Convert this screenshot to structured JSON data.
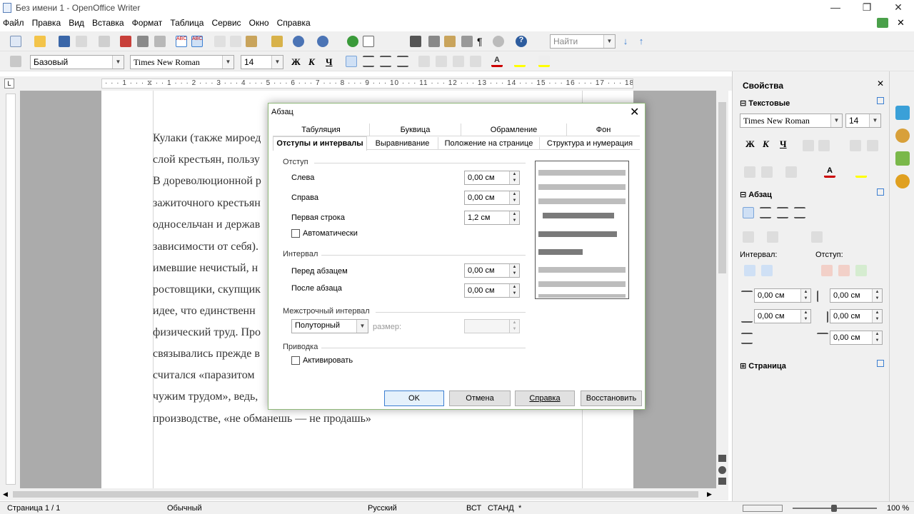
{
  "window": {
    "title": "Без имени 1 - OpenOffice Writer"
  },
  "menu": [
    "Файл",
    "Правка",
    "Вид",
    "Вставка",
    "Формат",
    "Таблица",
    "Сервис",
    "Окно",
    "Справка"
  ],
  "toolbar": {
    "find_placeholder": "Найти"
  },
  "formatting": {
    "style": "Базовый",
    "font": "Times New Roman",
    "size": "14",
    "bold": "Ж",
    "italic": "К",
    "underline": "Ч"
  },
  "ruler": {
    "marks": "· · · 1 · · · ⧖ · · 1 · · · 2 · · · 3 · · · 4 · · · 5 · · · 6 · · · 7 · · · 8 · · · 9 · · · 10 · · · 11 · · · 12 · · · 13 · · · 14 · · · 15 · · · 16 · · · 17 · · · 18 · ·"
  },
  "document": {
    "lines": [
      "Кулаки (также мироед",
      "слой крестьян, пользу",
      "В дореволюционной р",
      "зажиточного крестьян",
      "односельчан и держав",
      "зависимости от себя).",
      "имевшие нечистый, н",
      "ростовщики, скупщик",
      "идее, что единственн",
      "физический труд. Про",
      "связывались прежде в",
      "считался «паразитом",
      "чужим трудом», ведь,",
      "производстве, «не обманешь — не продашь»"
    ]
  },
  "status": {
    "page": "Страница  1 / 1",
    "style": "Обычный",
    "lang": "Русский",
    "mode1": "ВСТ",
    "mode2": "СТАНД",
    "mode3": "*",
    "zoom": "100 %"
  },
  "sidebar": {
    "title": "Свойства",
    "text_section": "Текстовые",
    "font": "Times New Roman",
    "size": "14",
    "bold": "Ж",
    "italic": "К",
    "underline": "Ч",
    "para_section": "Абзац",
    "interval_label": "Интервал:",
    "indent_label": "Отступ:",
    "spin_values": [
      "0,00 см",
      "0,00 см",
      "0,00 см",
      "0,00 см",
      "0,00 см"
    ],
    "page_section": "Страница"
  },
  "dialog": {
    "title": "Абзац",
    "tabs_row1": [
      "Табуляция",
      "Буквица",
      "Обрамление",
      "Фон"
    ],
    "tabs_row2": [
      "Отступы и интервалы",
      "Выравнивание",
      "Положение на странице",
      "Структура и нумерация"
    ],
    "indent_section": "Отступ",
    "left_label": "Слева",
    "left_value": "0,00 см",
    "right_label": "Справа",
    "right_value": "0,00 см",
    "first_line_label": "Первая строка",
    "first_line_value": "1,2 см",
    "auto_label": "Автоматически",
    "spacing_section": "Интервал",
    "before_label": "Перед абзацем",
    "before_value": "0,00 см",
    "after_label": "После абзаца",
    "after_value": "0,00 см",
    "line_spacing_section": "Межстрочный интервал",
    "line_spacing_value": "Полуторный",
    "size_label": "размер:",
    "register_section": "Приводка",
    "activate_label": "Активировать",
    "buttons": {
      "ok": "OK",
      "cancel": "Отмена",
      "help": "Справка",
      "reset": "Восстановить"
    }
  },
  "colors": {
    "accent": "#3c7fd1",
    "dialog_border": "#8fb879",
    "canvas": "#ababab"
  }
}
